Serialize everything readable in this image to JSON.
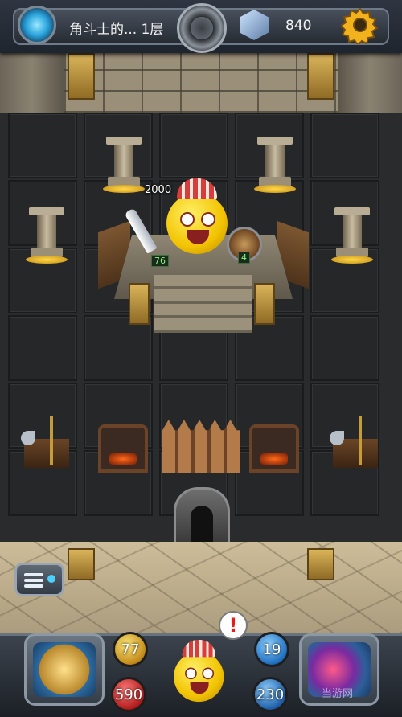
{
  "header": {
    "level_label": "角斗士的... 1层",
    "coins": "840"
  },
  "battle": {
    "enemy_reward": "2000",
    "hero_attack": "76",
    "hero_defense": "4"
  },
  "hud": {
    "attack": "77",
    "defense": "19",
    "health": "590",
    "mana": "230",
    "alert_symbol": "!"
  },
  "watermark": "当游网",
  "icons": {
    "portal": "portal-icon",
    "center": "compass-disc-icon",
    "gem": "gem-icon",
    "settings": "gear-icon",
    "menu": "menu-icon",
    "hero_skill": "hero-skill-icon",
    "inventory": "inventory-icon"
  },
  "colors": {
    "attack_orb": "#c28a1a",
    "health_orb": "#b21d1d",
    "defense_orb": "#1f6fc0",
    "alert": "#e11d1d"
  }
}
